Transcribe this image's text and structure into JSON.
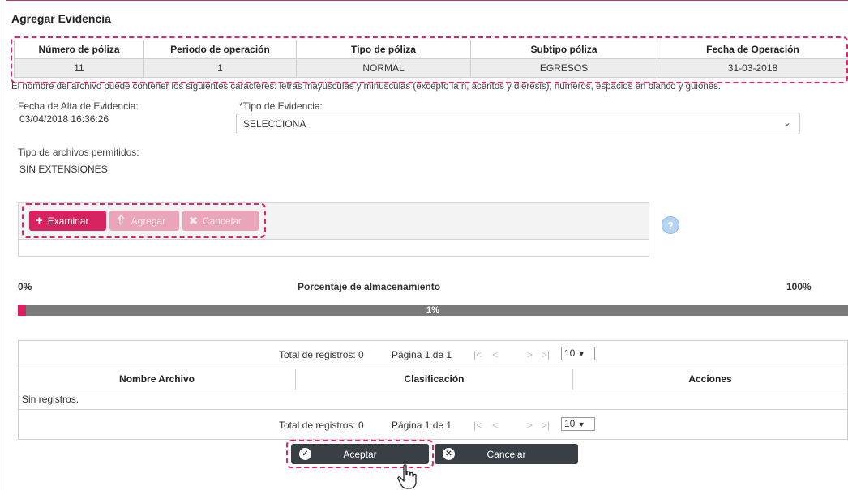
{
  "title": "Agregar Evidencia",
  "policy_table": {
    "headers": [
      "Número de póliza",
      "Periodo de operación",
      "Tipo de póliza",
      "Subtipo póliza",
      "Fecha de Operación"
    ],
    "row": [
      "11",
      "1",
      "NORMAL",
      "EGRESOS",
      "31-03-2018"
    ]
  },
  "filename_note": "El nombre del archivo puede contener los siguientes caracteres: letras mayúsculas y minúsculas (excepto la ñ, acentos y diéresis), números, espacios en blanco y guiones.",
  "alta": {
    "label": "Fecha de Alta de Evidencia:",
    "value": "03/04/2018 16:36:26"
  },
  "tipo_evidencia": {
    "label": "*Tipo de Evidencia:",
    "selected": "SELECCIONA"
  },
  "allowed": {
    "label": "Tipo de archivos permitidos:",
    "value": "SIN EXTENSIONES"
  },
  "upload": {
    "browse": "Examinar",
    "add": "Agregar",
    "cancel": "Cancelar"
  },
  "help_icon": "?",
  "storage": {
    "min_label": "0%",
    "title": "Porcentaje de almacenamiento",
    "max_label": "100%",
    "value_label": "1%",
    "value_percent": 1
  },
  "grid": {
    "total": "Total de registros: 0",
    "page": "Página 1 de 1",
    "nav": [
      "|<",
      "<",
      ">",
      ">|"
    ],
    "page_size": "10",
    "columns": [
      "Nombre Archivo",
      "Clasificación",
      "Acciones"
    ],
    "empty": "Sin registros."
  },
  "footer": {
    "accept": "Aceptar",
    "cancel": "Cancelar"
  },
  "colors": {
    "accent": "#d6235f",
    "highlight": "#e0226e",
    "dark_button": "#3a3f46"
  }
}
